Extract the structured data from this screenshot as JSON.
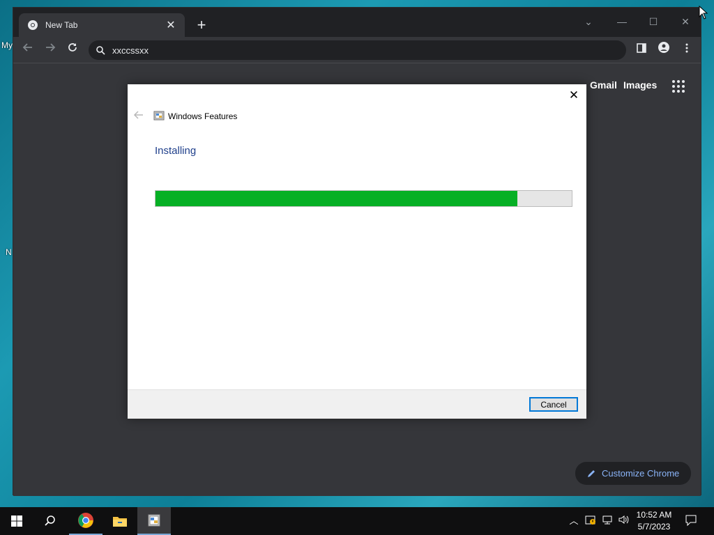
{
  "desktop": {
    "labels": [
      "My",
      "N"
    ]
  },
  "chrome": {
    "tab": {
      "title": "New Tab"
    },
    "omnibox": {
      "text": "xxccssxx"
    },
    "newtab_page": {
      "gmail": "Gmail",
      "images": "Images",
      "customize_label": "Customize Chrome"
    }
  },
  "dialog": {
    "window_title": "Windows Features",
    "heading": "Installing",
    "progress": 0.87,
    "progress_color": "#06b025",
    "cancel_label": "Cancel"
  },
  "taskbar": {
    "time": "10:52 AM",
    "date": "5/7/2023",
    "apps": [
      "windows-start-icon",
      "search-icon",
      "chrome-icon",
      "file-explorer-icon",
      "windows-features-icon"
    ]
  },
  "colors": {
    "accent": "#0078d7",
    "link_blue": "#8ab4f8",
    "heading_blue": "#1f3f8b"
  }
}
